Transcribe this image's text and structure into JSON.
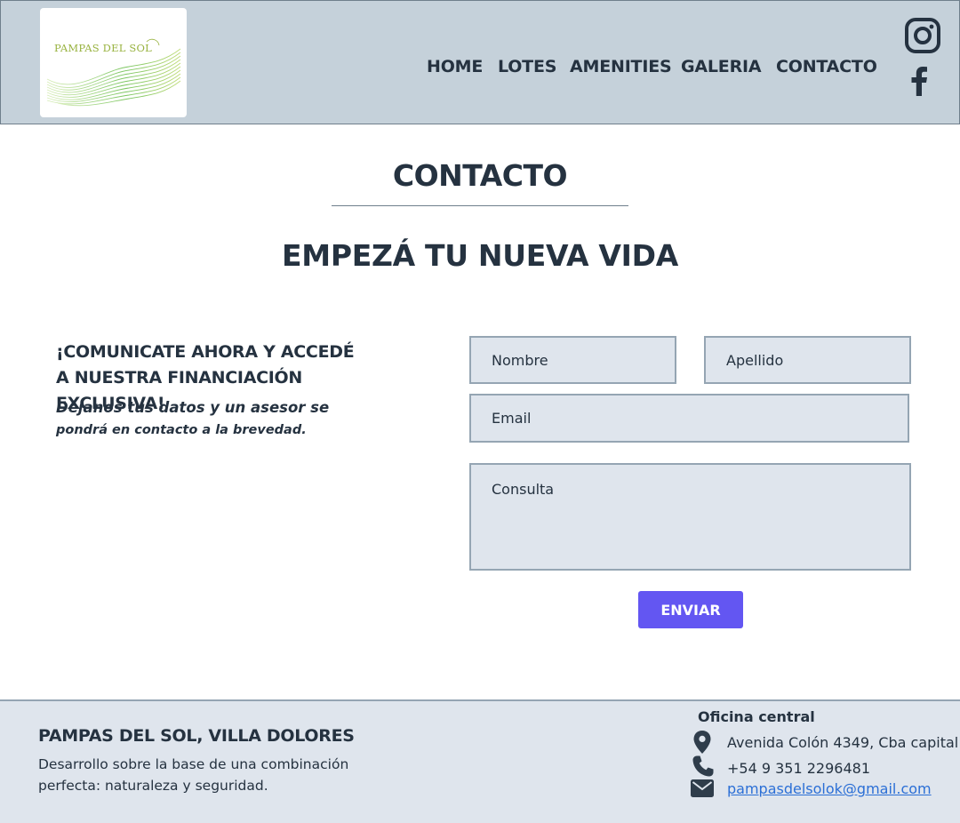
{
  "header": {
    "logo_text": "PAMPAS DEL SOL",
    "nav": [
      {
        "label": "HOME"
      },
      {
        "label": "LOTES"
      },
      {
        "label": "AMENITIES"
      },
      {
        "label": "GALERIA"
      },
      {
        "label": "CONTACTO"
      }
    ],
    "social": [
      "instagram-icon",
      "facebook-icon"
    ]
  },
  "main": {
    "section_title": "CONTACTO",
    "hero_title": "EMPEZÁ TU NUEVA VIDA",
    "cta_line1": "¡COMUNICATE AHORA Y ACCEDÉ",
    "cta_line2": "A NUESTRA FINANCIACIÓN EXCLUSIVA!",
    "note_line1": "Dejanos tus datos y un asesor se",
    "note_line2": "pondrá en contacto a la brevedad."
  },
  "form": {
    "nombre": {
      "placeholder": "Nombre",
      "value": ""
    },
    "apellido": {
      "placeholder": "Apellido",
      "value": ""
    },
    "email": {
      "placeholder": "Email",
      "value": ""
    },
    "consulta": {
      "placeholder": "Consulta",
      "value": ""
    },
    "submit_label": "ENVIAR"
  },
  "footer": {
    "title": "PAMPAS DEL SOL, VILLA DOLORES",
    "description_line1": "Desarrollo sobre la base de una combinación",
    "description_line2": "perfecta: naturaleza y seguridad.",
    "office_title": "Oficina central",
    "address": "Avenida Colón 4349, Cba capital",
    "phone": "+54 9 351 2296481",
    "email": "pampasdelsolok@gmail.com"
  },
  "colors": {
    "header_bg": "#c5d1da",
    "text": "#253240",
    "field_bg": "#dfe5ed",
    "button": "#6356f2",
    "link": "#2b6fd6"
  }
}
